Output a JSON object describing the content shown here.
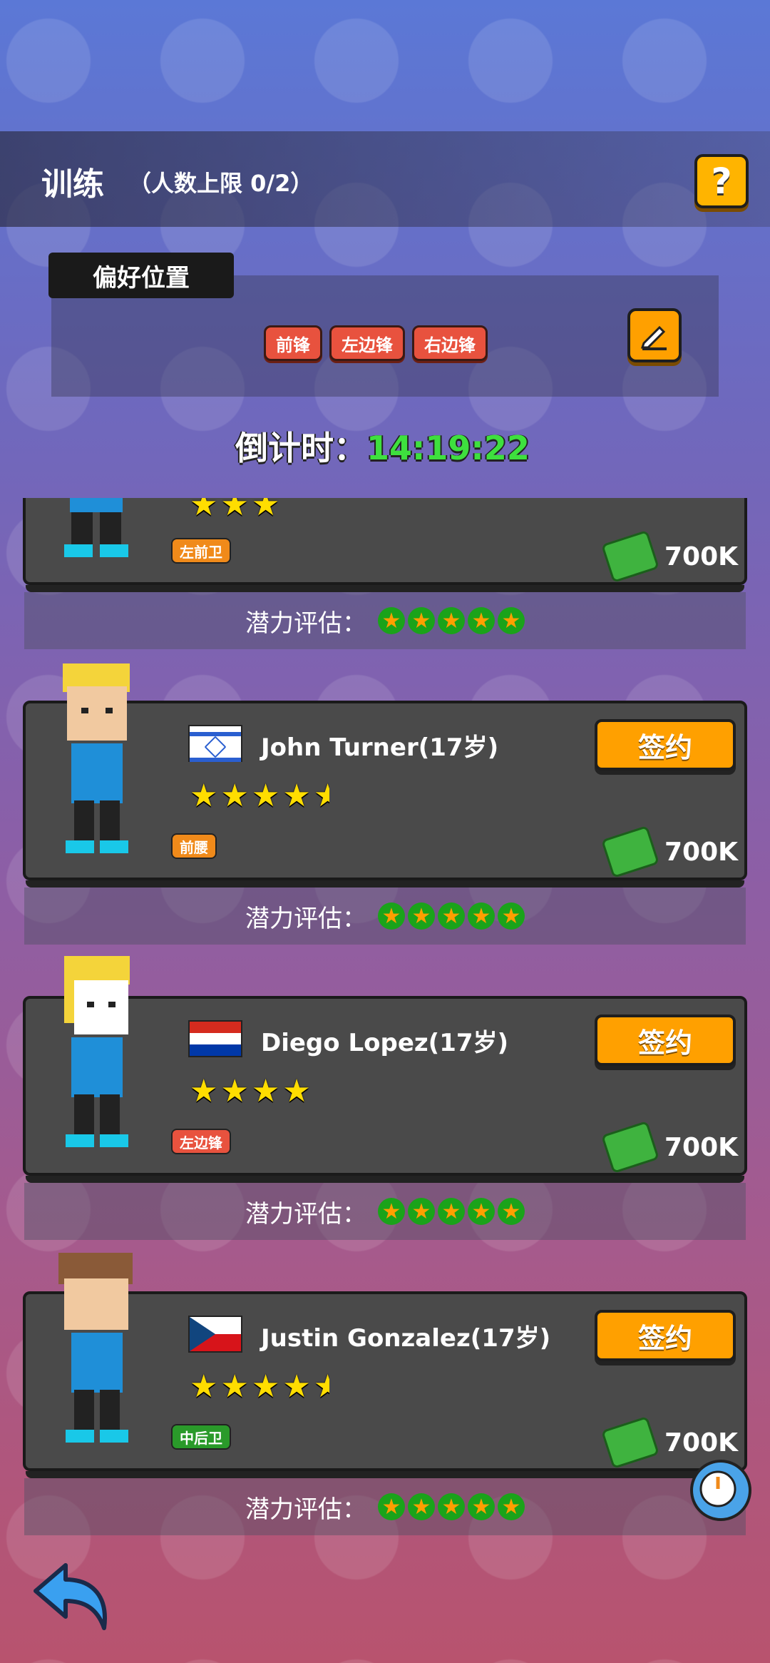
{
  "header": {
    "title": "训练",
    "subtitle": "（人数上限 0/2）",
    "help_label": "?"
  },
  "preference": {
    "tab_label": "偏好位置",
    "tags": [
      "前锋",
      "左边锋",
      "右边锋"
    ]
  },
  "countdown": {
    "label": "倒计时：",
    "time": "14:19:22"
  },
  "potential_label": "潜力评估：",
  "players": [
    {
      "name": "",
      "flag": "",
      "rating": 3,
      "position": "左前卫",
      "position_color": "#f08a1a",
      "price": "700K",
      "potential": 5,
      "sign_label": ""
    },
    {
      "name": "John Turner(17岁)",
      "flag": "israel",
      "rating": 4.5,
      "position": "前腰",
      "position_color": "#f08a1a",
      "price": "700K",
      "potential": 5,
      "sign_label": "签约"
    },
    {
      "name": "Diego Lopez(17岁)",
      "flag": "paraguay",
      "rating": 4,
      "position": "左边锋",
      "position_color": "#e8523e",
      "price": "700K",
      "potential": 5,
      "sign_label": "签约"
    },
    {
      "name": "Justin Gonzalez(17岁)",
      "flag": "czech",
      "rating": 4.5,
      "position": "中后卫",
      "position_color": "#2a9a2a",
      "price": "700K",
      "potential": 5,
      "sign_label": "签约"
    }
  ],
  "colors": {
    "accent": "#ffa000",
    "countdown": "#3ee03e"
  }
}
